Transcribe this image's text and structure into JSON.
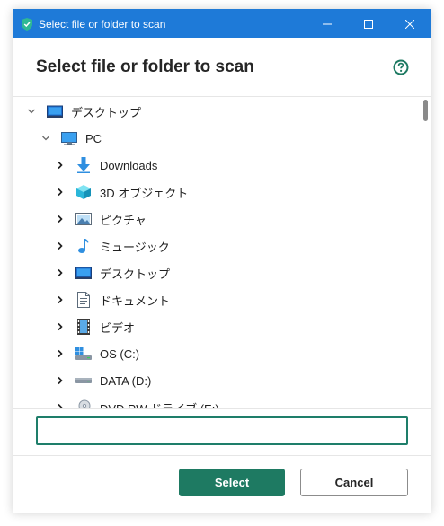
{
  "window": {
    "title": "Select file or folder to scan"
  },
  "dialog": {
    "heading": "Select file or folder to scan"
  },
  "tree": {
    "items": [
      {
        "label": "デスクトップ",
        "icon": "desktop-icon",
        "expanded": true
      },
      {
        "label": "PC",
        "icon": "pc-icon",
        "expanded": true
      },
      {
        "label": "Downloads",
        "icon": "downloads-icon",
        "expanded": false
      },
      {
        "label": "3D オブジェクト",
        "icon": "3d-objects-icon",
        "expanded": false
      },
      {
        "label": "ピクチャ",
        "icon": "pictures-icon",
        "expanded": false
      },
      {
        "label": "ミュージック",
        "icon": "music-icon",
        "expanded": false
      },
      {
        "label": "デスクトップ",
        "icon": "desktop-icon",
        "expanded": false
      },
      {
        "label": "ドキュメント",
        "icon": "documents-icon",
        "expanded": false
      },
      {
        "label": "ビデオ",
        "icon": "videos-icon",
        "expanded": false
      },
      {
        "label": "OS (C:)",
        "icon": "drive-c-icon",
        "expanded": false
      },
      {
        "label": "DATA (D:)",
        "icon": "drive-d-icon",
        "expanded": false
      },
      {
        "label": "DVD RW ドライブ (E:)",
        "icon": "dvd-drive-icon",
        "expanded": false
      }
    ]
  },
  "path": {
    "value": "",
    "placeholder": ""
  },
  "buttons": {
    "select": "Select",
    "cancel": "Cancel"
  },
  "colors": {
    "titlebar": "#1e7ad8",
    "accent": "#1e7a62",
    "help": "#1e7a62"
  }
}
